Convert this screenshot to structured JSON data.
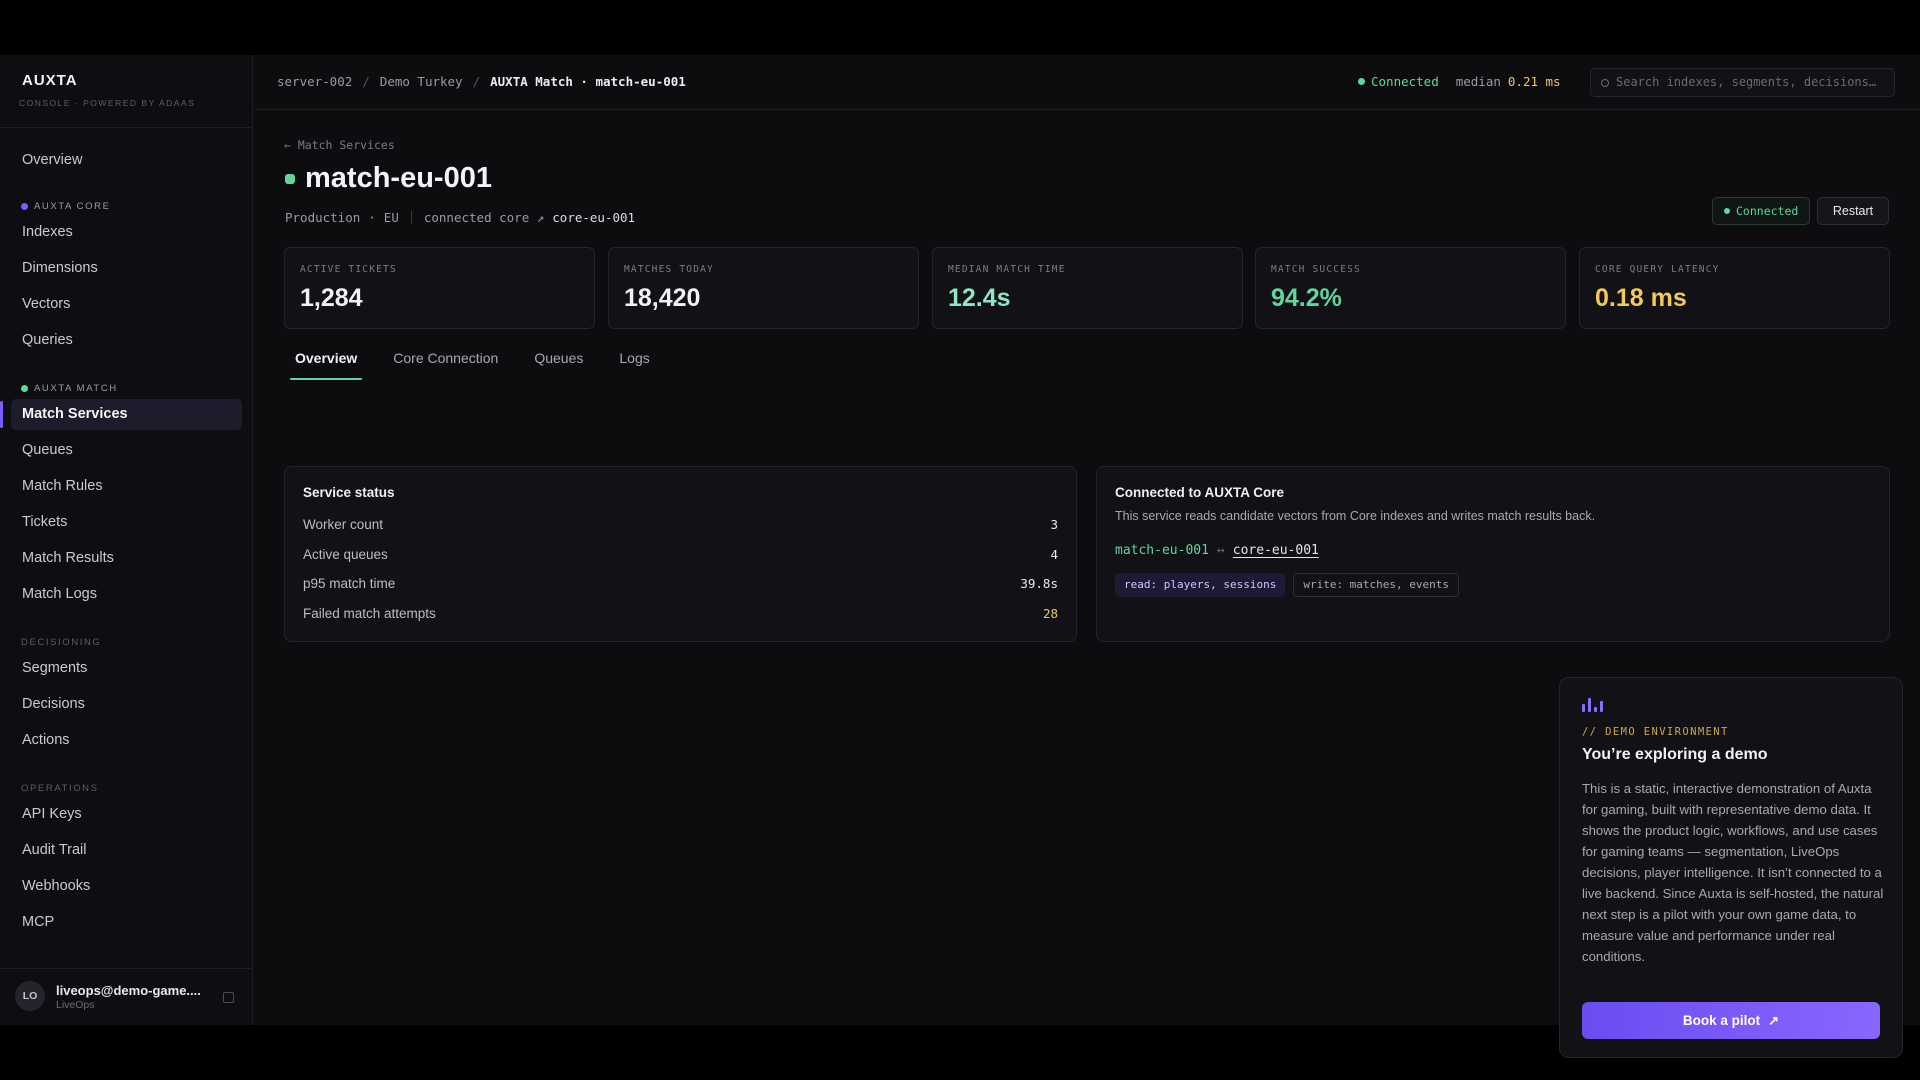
{
  "brand": {
    "logo": "AUXTA",
    "subtitle": "CONSOLE · POWERED BY ADAAS"
  },
  "sidebar": {
    "overview": "Overview",
    "core_section": "AUXTA CORE",
    "core_items": [
      "Indexes",
      "Dimensions",
      "Vectors",
      "Queries"
    ],
    "match_section": "AUXTA MATCH",
    "match_items": [
      "Match Services",
      "Queues",
      "Match Rules",
      "Tickets",
      "Match Results",
      "Match Logs"
    ],
    "decisioning_section": "DECISIONING",
    "decisioning_items": [
      "Segments",
      "Decisions",
      "Actions"
    ],
    "operations_section": "OPERATIONS",
    "operations_items": [
      "API Keys",
      "Audit Trail",
      "Webhooks",
      "MCP"
    ],
    "active_item": "Match Services"
  },
  "user": {
    "initials": "LO",
    "email": "liveops@demo-game....",
    "role": "LiveOps"
  },
  "topbar": {
    "breadcrumbs": [
      "server-002",
      "Demo Turkey",
      "AUXTA Match · match-eu-001"
    ],
    "status": "Connected",
    "median_label": "median",
    "median_value": "0.21 ms",
    "search_placeholder": "Search indexes, segments, decisions…"
  },
  "page": {
    "back_link": "← Match Services",
    "title": "match-eu-001",
    "env": "Production",
    "region": "EU",
    "core_label": "connected core ↗",
    "core_id": "core-eu-001",
    "status_pill": "Connected",
    "restart_label": "Restart"
  },
  "kpis": [
    {
      "label": "ACTIVE TICKETS",
      "value": "1,284",
      "color": "#f2f2f6"
    },
    {
      "label": "MATCHES TODAY",
      "value": "18,420",
      "color": "#f2f2f6"
    },
    {
      "label": "MEDIAN MATCH TIME",
      "value": "12.4s",
      "color": "#8fe6c4"
    },
    {
      "label": "MATCH SUCCESS",
      "value": "94.2%",
      "color": "#5fd69c"
    },
    {
      "label": "CORE QUERY LATENCY",
      "value": "0.18 ms",
      "color": "#f0c95a"
    }
  ],
  "tabs": [
    "Overview",
    "Core Connection",
    "Queues",
    "Logs"
  ],
  "service_status": {
    "title": "Service status",
    "rows": [
      {
        "label": "Worker count",
        "value": "3"
      },
      {
        "label": "Active queues",
        "value": "4"
      },
      {
        "label": "p95 match time",
        "value": "39.8s"
      },
      {
        "label": "Failed match attempts",
        "value": "28"
      }
    ]
  },
  "core_card": {
    "title": "Connected to AUXTA Core",
    "description": "This service reads candidate vectors from Core indexes and writes match results back.",
    "from": "match-eu-001",
    "arrow": "↔",
    "to": "core-eu-001",
    "read_tag": "read: players, sessions",
    "write_tag": "write: matches, events"
  },
  "demo": {
    "label": "// DEMO ENVIRONMENT",
    "title": "You’re exploring a demo",
    "body": "This is a static, interactive demonstration of Auxta for gaming, built with representative demo data. It shows the product logic, workflows, and use cases for gaming teams — segmentation, LiveOps decisions, player intelligence. It isn’t connected to a live backend. Since Auxta is self-hosted, the natural next step is a pilot with your own game data, to measure value and performance under real conditions.",
    "button": "Book a pilot",
    "button_icon": "↗"
  },
  "colors": {
    "accent": "#7c5cff",
    "success": "#5fd69c",
    "warning": "#e7c86b"
  }
}
